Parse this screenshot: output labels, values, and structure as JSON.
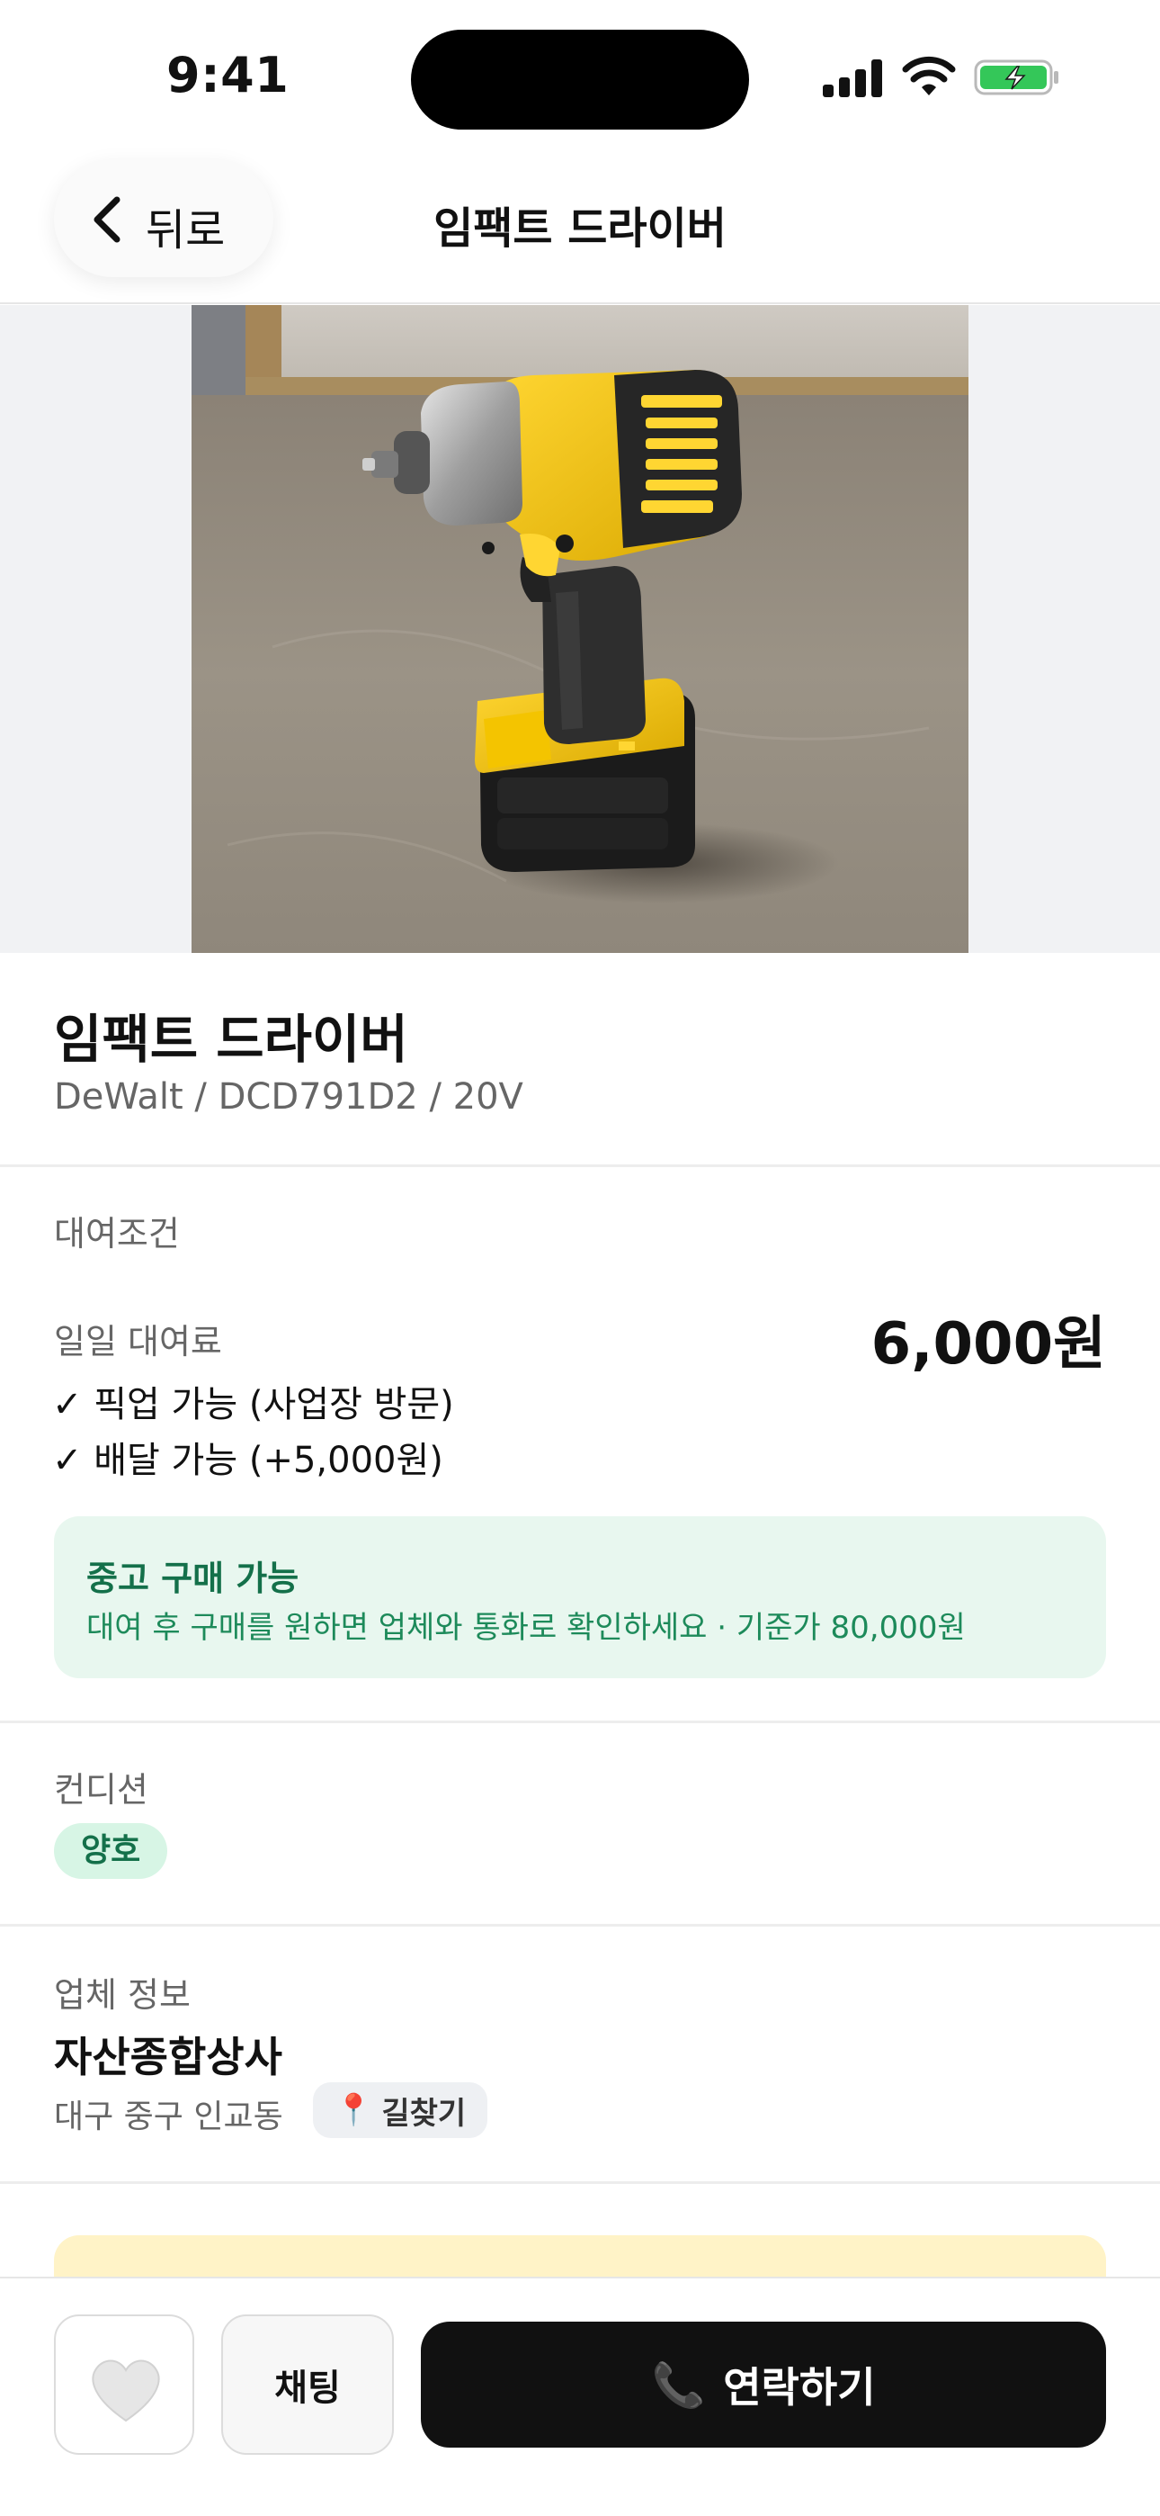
{
  "status_bar": {
    "time": "9:41"
  },
  "nav": {
    "back_label": "뒤로",
    "title": "임팩트 드라이버"
  },
  "product": {
    "title": "임팩트 드라이버",
    "subtitle": "DeWalt / DCD791D2 / 20V"
  },
  "rental": {
    "section_label": "대여조건",
    "rate_label": "일일 대여료",
    "rate_value": "6,000원",
    "options": [
      "✓ 픽업 가능 (사업장 방문)",
      "✓ 배달 가능 (+5,000원)"
    ],
    "buy_title": "중고 구매 가능",
    "buy_desc": "대여 후 구매를 원하면 업체와 통화로 확인하세요 · 기준가 80,000원"
  },
  "condition": {
    "section_label": "컨디션",
    "badge": "양호"
  },
  "vendor": {
    "section_label": "업체 정보",
    "name": "자산종합상사",
    "address": "대구 중구 인교동",
    "route_label": "길찾기"
  },
  "bottom": {
    "chat_label": "채팅",
    "call_label": "연락하기"
  },
  "colors": {
    "accent_green": "#14704a",
    "buy_box_bg": "#e8f7ef",
    "call_button": "#111111",
    "battery_green": "#34c759"
  },
  "icons": {
    "back": "chevron-left-icon",
    "favorite": "heart-icon",
    "route": "pin-icon",
    "call": "phone-icon"
  }
}
